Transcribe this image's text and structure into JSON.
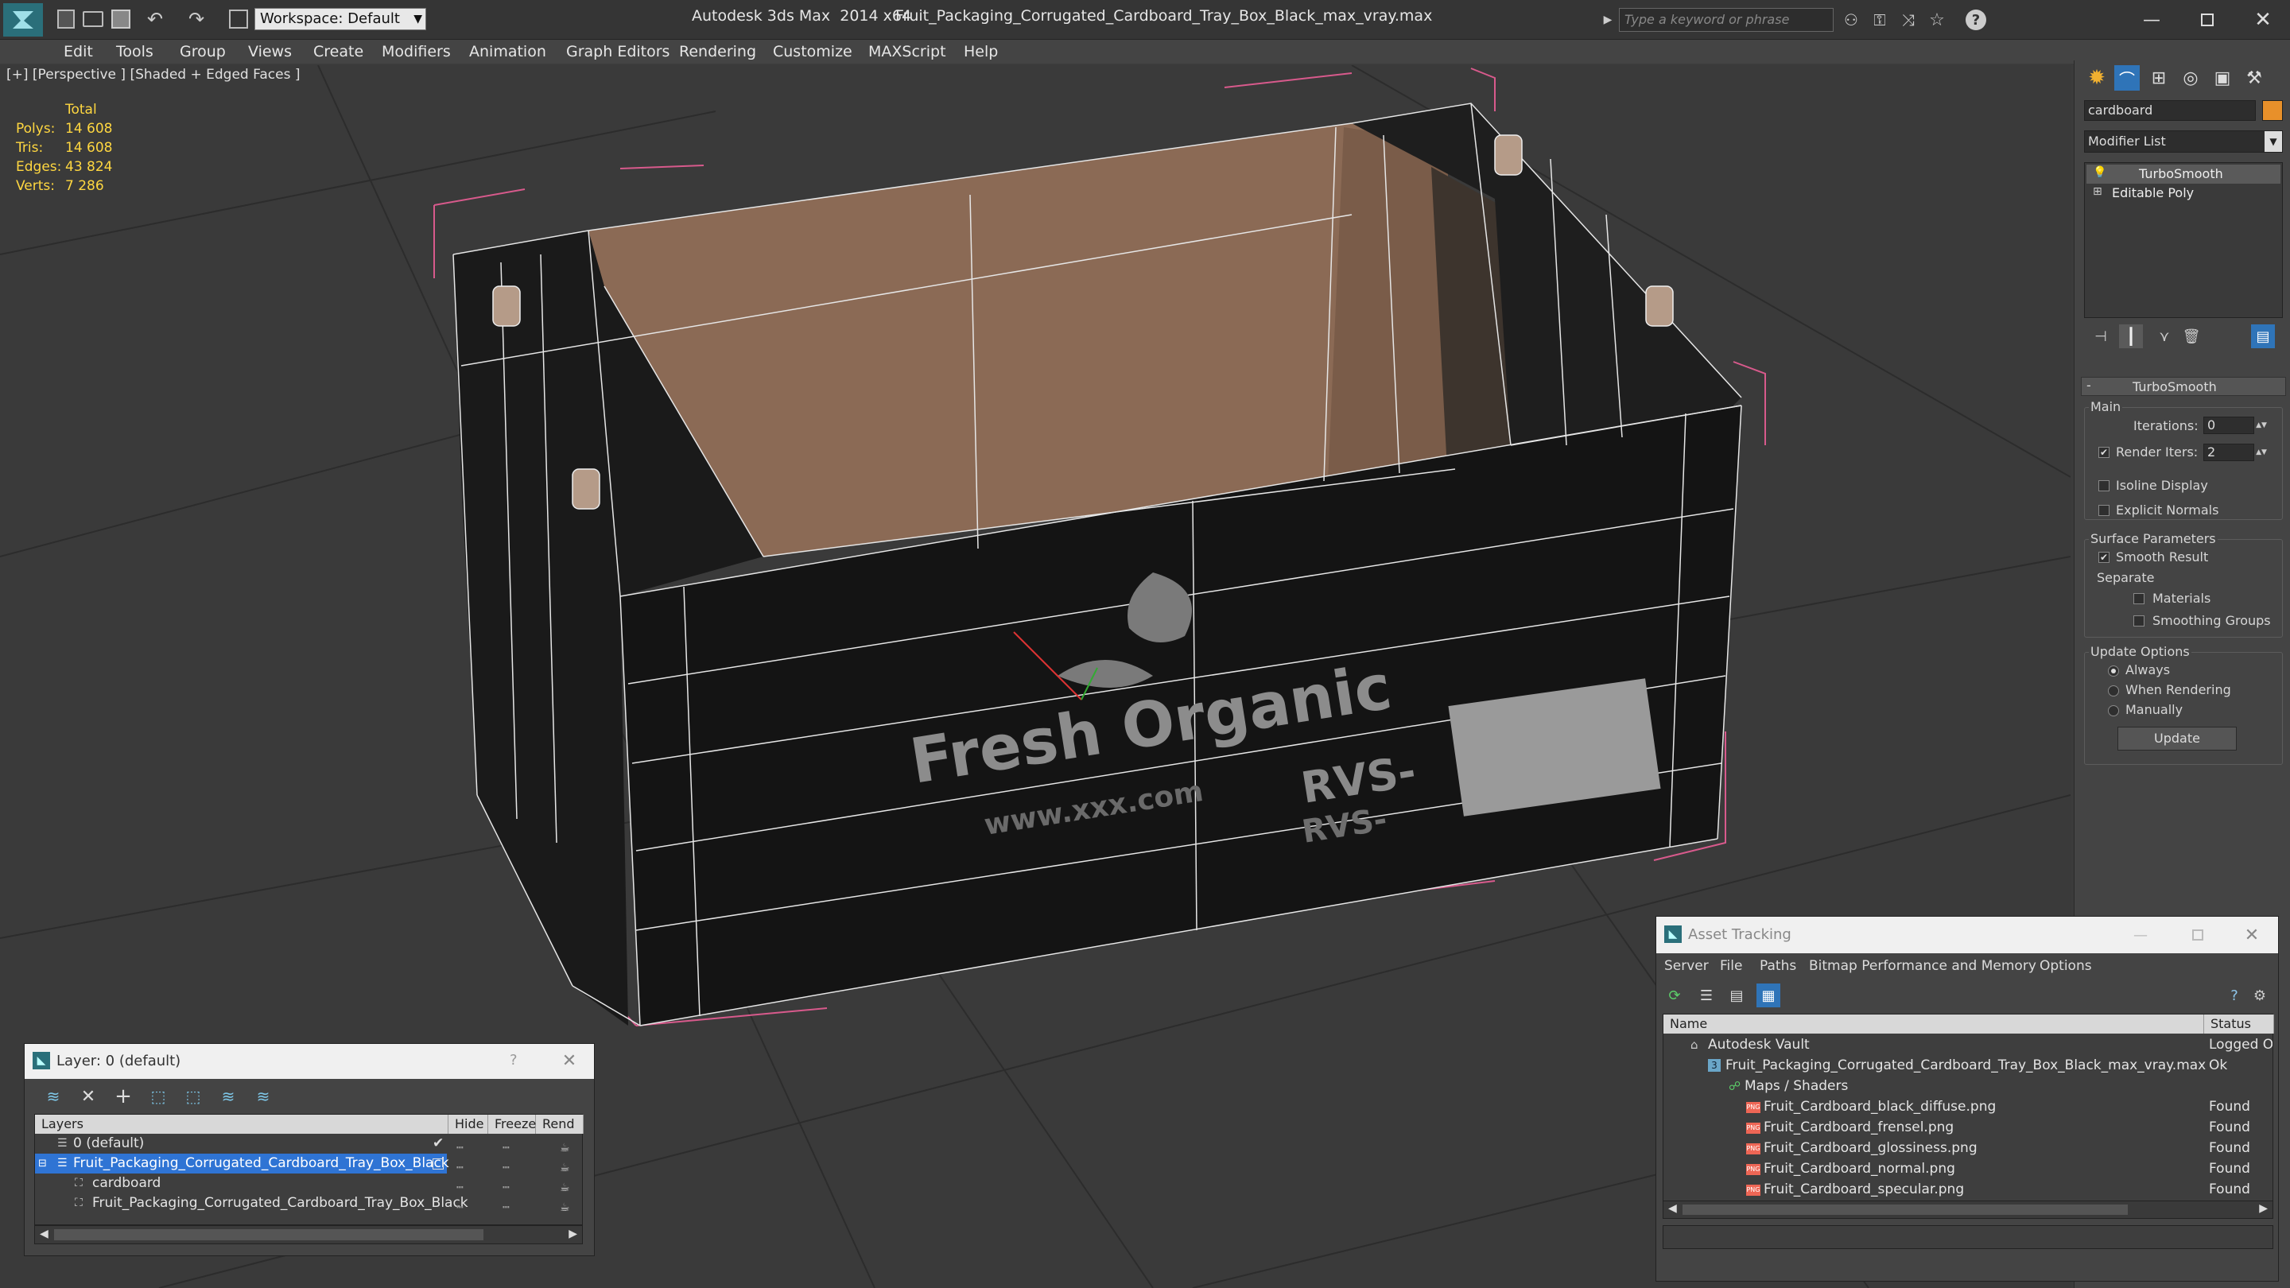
{
  "titlebar": {
    "workspace": "Workspace: Default",
    "app_title": "Autodesk 3ds Max  2014 x64",
    "file_title": "Fruit_Packaging_Corrugated_Cardboard_Tray_Box_Black_max_vray.max",
    "search_placeholder": "Type a keyword or phrase"
  },
  "menu": [
    "Edit",
    "Tools",
    "Group",
    "Views",
    "Create",
    "Modifiers",
    "Animation",
    "Graph Editors",
    "Rendering",
    "Customize",
    "MAXScript",
    "Help"
  ],
  "viewport": {
    "label": "[+] [Perspective ] [Shaded + Edged Faces ]",
    "stats": {
      "header": "Total",
      "rows": [
        {
          "label": "Polys:",
          "value": "14 608"
        },
        {
          "label": "Tris:",
          "value": "14 608"
        },
        {
          "label": "Edges:",
          "value": "43 824"
        },
        {
          "label": "Verts:",
          "value": "7 286"
        }
      ]
    },
    "box_print_main": "Fresh Organic",
    "box_print_sub": "www.xxx.com",
    "box_print_side": "RVS-",
    "box_print_side2": "RVS-"
  },
  "cmdpanel": {
    "object_name": "cardboard",
    "object_color": "#e8902a",
    "modifier_list": "Modifier List",
    "stack": [
      "TurboSmooth",
      "Editable Poly"
    ],
    "rollout_title": "TurboSmooth",
    "main_group": "Main",
    "iterations_label": "Iterations:",
    "iterations_value": "0",
    "render_iters_label": "Render Iters:",
    "render_iters_value": "2",
    "render_iters_checked": "✔",
    "isoline": "Isoline Display",
    "explicit": "Explicit Normals",
    "surface_group": "Surface Parameters",
    "smooth_result": "Smooth Result",
    "smooth_checked": "✔",
    "separate": "Separate",
    "materials": "Materials",
    "smoothing_groups": "Smoothing Groups",
    "update_group": "Update Options",
    "always": "Always",
    "when_rendering": "When Rendering",
    "manually": "Manually",
    "update_button": "Update"
  },
  "layer_window": {
    "title": "Layer: 0 (default)",
    "help": "?",
    "columns": [
      "Layers",
      "Hide",
      "Freeze",
      "Rend"
    ],
    "rows": [
      {
        "name": "0 (default)"
      },
      {
        "name": "Fruit_Packaging_Corrugated_Cardboard_Tray_Box_Black"
      },
      {
        "name": "cardboard"
      },
      {
        "name": "Fruit_Packaging_Corrugated_Cardboard_Tray_Box_Black"
      }
    ],
    "current_check": "✔"
  },
  "asset_window": {
    "title": "Asset Tracking",
    "menu": [
      "Server",
      "File",
      "Paths",
      "Bitmap Performance and Memory",
      "Options"
    ],
    "columns": [
      "Name",
      "Status"
    ],
    "rows": [
      {
        "name": "Autodesk Vault",
        "status": "Logged Ou"
      },
      {
        "name": "Fruit_Packaging_Corrugated_Cardboard_Tray_Box_Black_max_vray.max",
        "status": "Ok"
      },
      {
        "name": "Maps / Shaders",
        "status": ""
      },
      {
        "name": "Fruit_Cardboard_black_diffuse.png",
        "status": "Found"
      },
      {
        "name": "Fruit_Cardboard_frensel.png",
        "status": "Found"
      },
      {
        "name": "Fruit_Cardboard_glossiness.png",
        "status": "Found"
      },
      {
        "name": "Fruit_Cardboard_normal.png",
        "status": "Found"
      },
      {
        "name": "Fruit_Cardboard_specular.png",
        "status": "Found"
      }
    ]
  }
}
